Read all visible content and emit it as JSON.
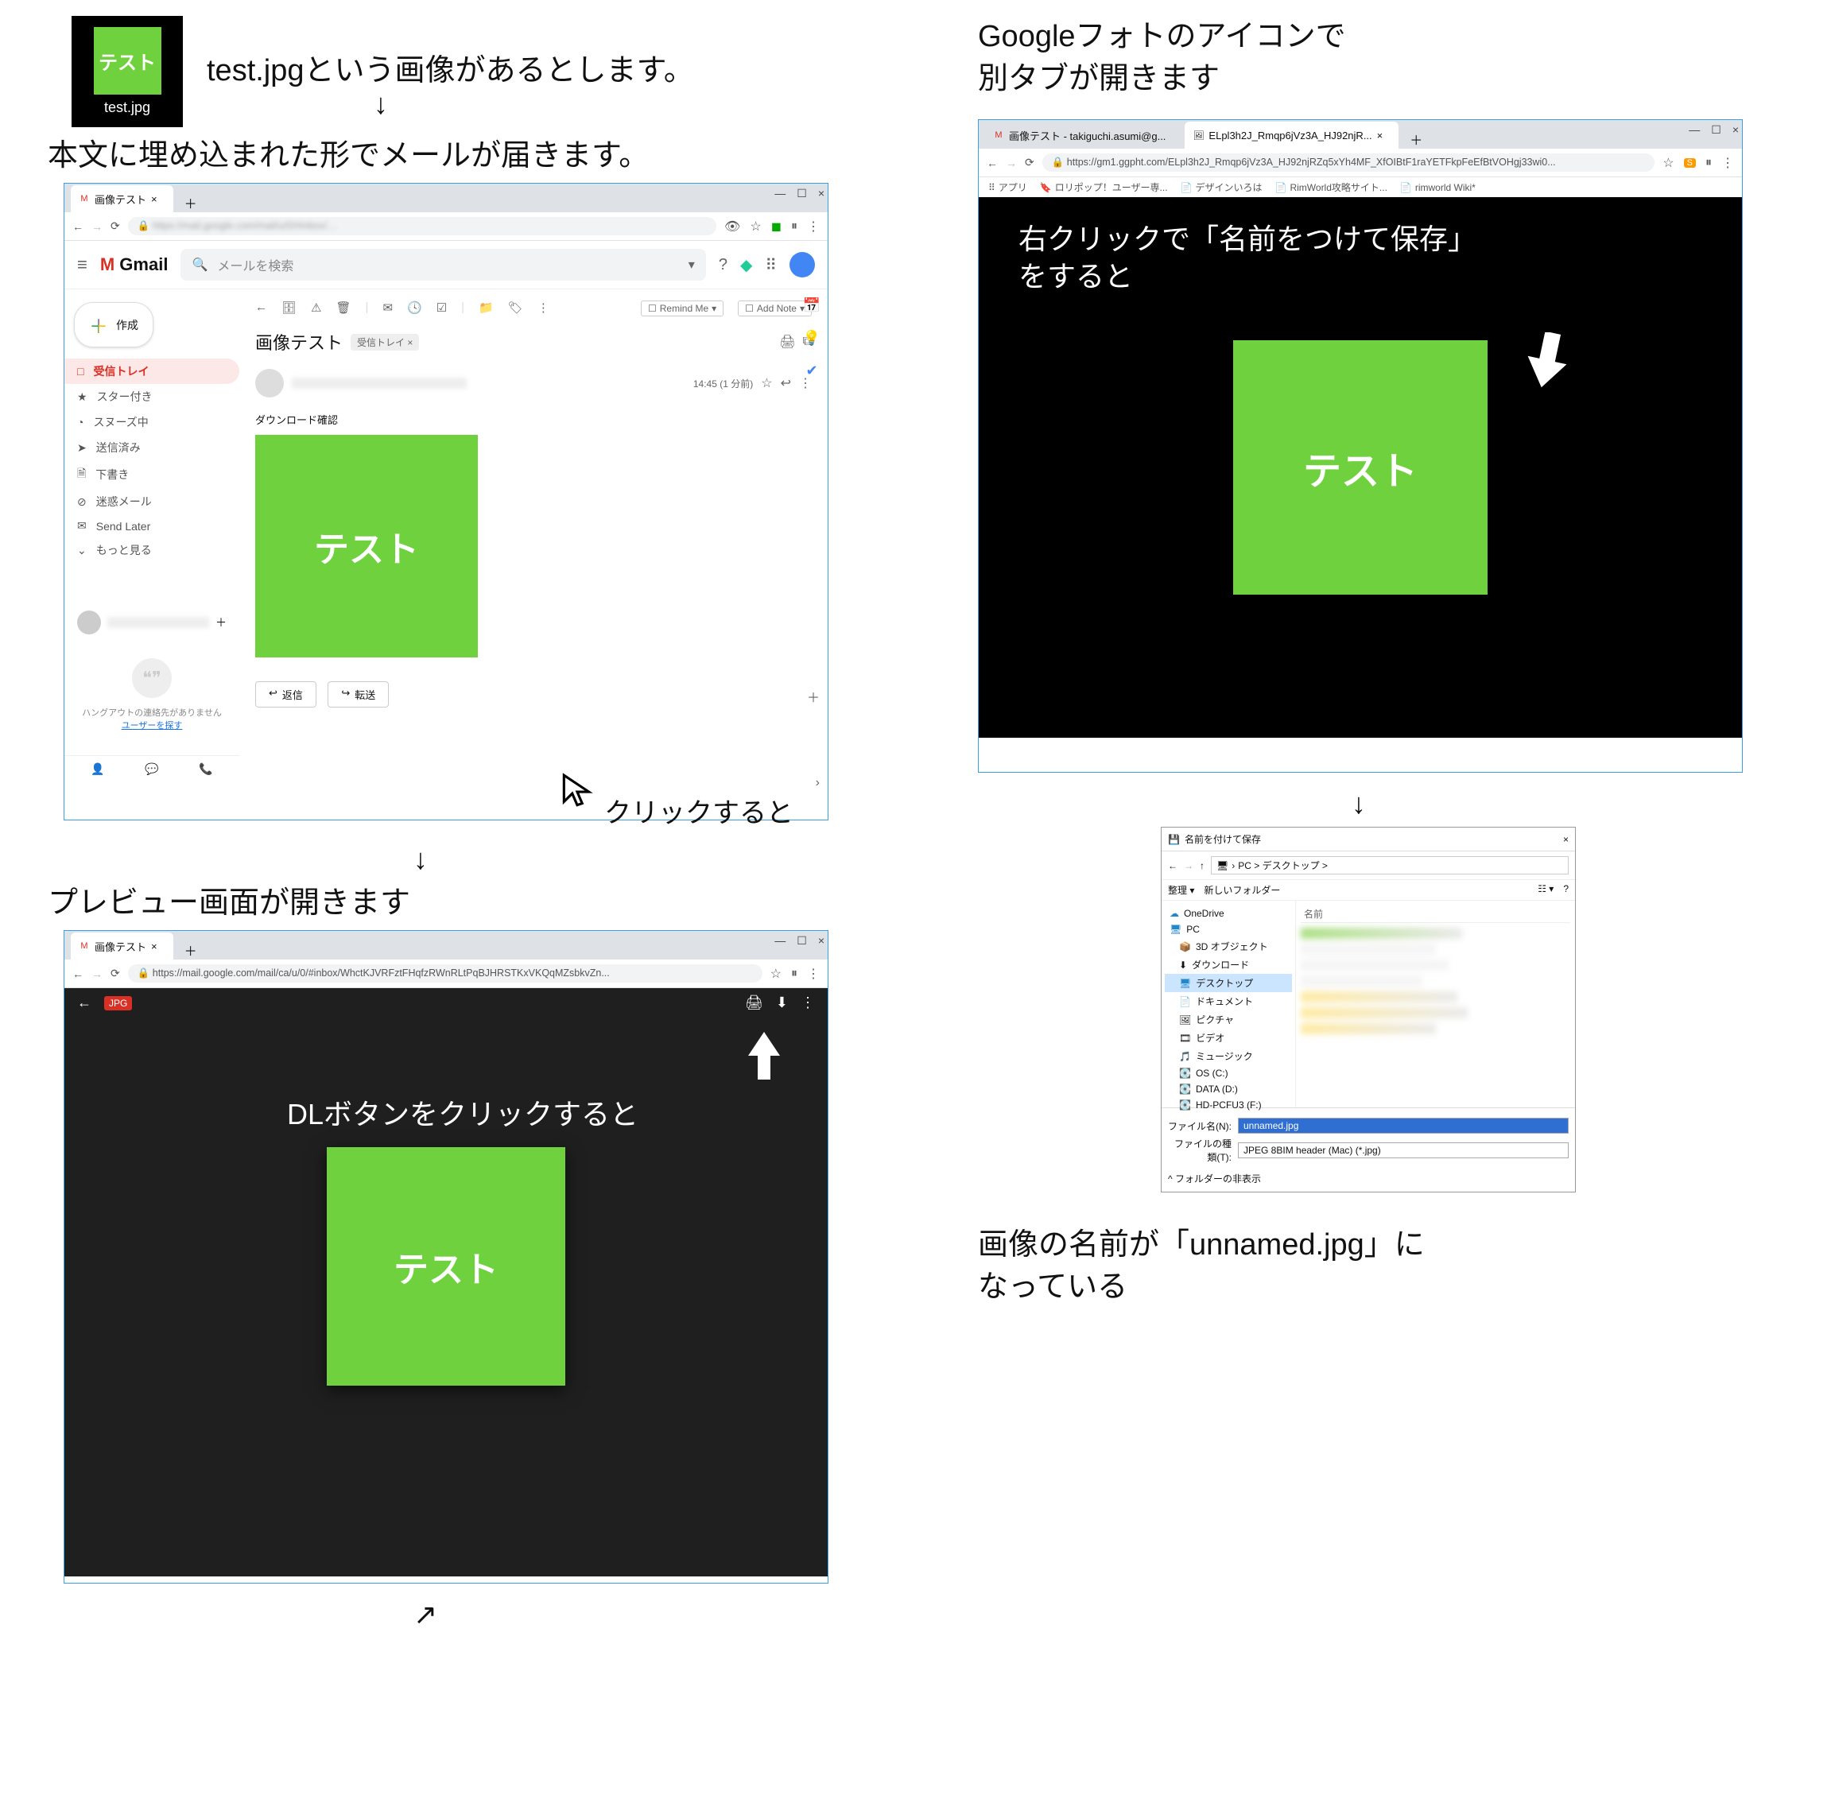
{
  "file_icon": {
    "caption": "テスト",
    "filename": "test.jpg"
  },
  "step1_caption": "test.jpgという画像があるとします。",
  "step2_caption": "本文に埋め込まれた形でメールが届きます。",
  "step3_caption": "Googleフォトのアイコンで\n別タブが開きます",
  "step4_caption": "プレビュー画面が開きます",
  "step5_caption": "画像の名前が「unnamed.jpg」に\nなっている",
  "overlay_click": "クリックすると",
  "overlay_dl": "DLボタンをクリックすると",
  "overlay_rightclick": "右クリックで「名前をつけて保存」\nをすると",
  "arrow_down": "↓",
  "arrow_upright": "↗",
  "gmail_window": {
    "tab_title": "画像テスト",
    "app_name": "Gmail",
    "search_placeholder": "メールを検索",
    "compose": "作成",
    "sidebar": {
      "items": [
        {
          "icon": "□",
          "label": "受信トレイ"
        },
        {
          "icon": "★",
          "label": "スター付き"
        },
        {
          "icon": "◔",
          "label": "スヌーズ中"
        },
        {
          "icon": "➤",
          "label": "送信済み"
        },
        {
          "icon": "🗎",
          "label": "下書き"
        },
        {
          "icon": "⊘",
          "label": "迷惑メール"
        },
        {
          "icon": "✉",
          "label": "Send Later"
        },
        {
          "icon": "⌄",
          "label": "もっと見る"
        }
      ]
    },
    "hangout_msg": "ハングアウトの連絡先がありません",
    "hangout_link": "ユーザーを探す",
    "subject": "画像テスト",
    "badge": "受信トレイ ×",
    "time": "14:45 (1 分前)",
    "body_title": "ダウンロード確認",
    "img_text": "テスト",
    "reply": "返信",
    "forward": "転送",
    "remind": "Remind Me",
    "addnote": "Add Note"
  },
  "preview_window": {
    "tab_title": "画像テスト",
    "url": "https://mail.google.com/mail/ca/u/0/#inbox/WhctKJVRFztFHqfzRWnRLtPqBJHRSTKxVKQqMZsbkvZn...",
    "img_text": "テスト"
  },
  "photo_window": {
    "tab1": "画像テスト - takiguchi.asumi@g...",
    "tab2": "ELpl3h2J_Rmqp6jVz3A_HJ92njR...",
    "url": "https://gm1.ggpht.com/ELpl3h2J_Rmqp6jVz3A_HJ92njRZq5xYh4MF_XfOIBtF1raYETFkpFeEfBtVOHgj33wi0...",
    "bookmarks": [
      "アプリ",
      "ロリポップ！ユーザー専...",
      "デザインいろは",
      "RimWorld攻略サイト...",
      "rimworld Wiki*"
    ],
    "img_text": "テスト"
  },
  "save_dialog": {
    "title": "名前を付けて保存",
    "path": "PC > デスクトップ >",
    "organize": "整理 ▾",
    "newfolder": "新しいフォルダー",
    "nav": [
      "OneDrive",
      "PC",
      "3D オブジェクト",
      "ダウンロード",
      "デスクトップ",
      "ドキュメント",
      "ピクチャ",
      "ビデオ",
      "ミュージック",
      "OS (C:)",
      "DATA (D:)",
      "HD-PCFU3 (F:)"
    ],
    "nav_selected_index": 4,
    "name_header": "名前",
    "filename_label": "ファイル名(N):",
    "filetype_label": "ファイルの種類(T):",
    "filename_value": "unnamed.jpg",
    "filetype_value": "JPEG 8BIM header (Mac) (*.jpg)",
    "hide_folders": "^ フォルダーの非表示"
  }
}
